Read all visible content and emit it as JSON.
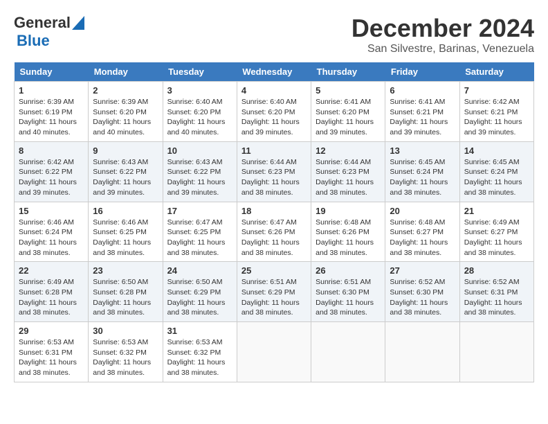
{
  "logo": {
    "general": "General",
    "blue": "Blue"
  },
  "title": "December 2024",
  "subtitle": "San Silvestre, Barinas, Venezuela",
  "days_header": [
    "Sunday",
    "Monday",
    "Tuesday",
    "Wednesday",
    "Thursday",
    "Friday",
    "Saturday"
  ],
  "weeks": [
    [
      {
        "day": "1",
        "sunrise": "Sunrise: 6:39 AM",
        "sunset": "Sunset: 6:19 PM",
        "daylight": "Daylight: 11 hours and 40 minutes."
      },
      {
        "day": "2",
        "sunrise": "Sunrise: 6:39 AM",
        "sunset": "Sunset: 6:20 PM",
        "daylight": "Daylight: 11 hours and 40 minutes."
      },
      {
        "day": "3",
        "sunrise": "Sunrise: 6:40 AM",
        "sunset": "Sunset: 6:20 PM",
        "daylight": "Daylight: 11 hours and 40 minutes."
      },
      {
        "day": "4",
        "sunrise": "Sunrise: 6:40 AM",
        "sunset": "Sunset: 6:20 PM",
        "daylight": "Daylight: 11 hours and 39 minutes."
      },
      {
        "day": "5",
        "sunrise": "Sunrise: 6:41 AM",
        "sunset": "Sunset: 6:20 PM",
        "daylight": "Daylight: 11 hours and 39 minutes."
      },
      {
        "day": "6",
        "sunrise": "Sunrise: 6:41 AM",
        "sunset": "Sunset: 6:21 PM",
        "daylight": "Daylight: 11 hours and 39 minutes."
      },
      {
        "day": "7",
        "sunrise": "Sunrise: 6:42 AM",
        "sunset": "Sunset: 6:21 PM",
        "daylight": "Daylight: 11 hours and 39 minutes."
      }
    ],
    [
      {
        "day": "8",
        "sunrise": "Sunrise: 6:42 AM",
        "sunset": "Sunset: 6:22 PM",
        "daylight": "Daylight: 11 hours and 39 minutes."
      },
      {
        "day": "9",
        "sunrise": "Sunrise: 6:43 AM",
        "sunset": "Sunset: 6:22 PM",
        "daylight": "Daylight: 11 hours and 39 minutes."
      },
      {
        "day": "10",
        "sunrise": "Sunrise: 6:43 AM",
        "sunset": "Sunset: 6:22 PM",
        "daylight": "Daylight: 11 hours and 39 minutes."
      },
      {
        "day": "11",
        "sunrise": "Sunrise: 6:44 AM",
        "sunset": "Sunset: 6:23 PM",
        "daylight": "Daylight: 11 hours and 38 minutes."
      },
      {
        "day": "12",
        "sunrise": "Sunrise: 6:44 AM",
        "sunset": "Sunset: 6:23 PM",
        "daylight": "Daylight: 11 hours and 38 minutes."
      },
      {
        "day": "13",
        "sunrise": "Sunrise: 6:45 AM",
        "sunset": "Sunset: 6:24 PM",
        "daylight": "Daylight: 11 hours and 38 minutes."
      },
      {
        "day": "14",
        "sunrise": "Sunrise: 6:45 AM",
        "sunset": "Sunset: 6:24 PM",
        "daylight": "Daylight: 11 hours and 38 minutes."
      }
    ],
    [
      {
        "day": "15",
        "sunrise": "Sunrise: 6:46 AM",
        "sunset": "Sunset: 6:24 PM",
        "daylight": "Daylight: 11 hours and 38 minutes."
      },
      {
        "day": "16",
        "sunrise": "Sunrise: 6:46 AM",
        "sunset": "Sunset: 6:25 PM",
        "daylight": "Daylight: 11 hours and 38 minutes."
      },
      {
        "day": "17",
        "sunrise": "Sunrise: 6:47 AM",
        "sunset": "Sunset: 6:25 PM",
        "daylight": "Daylight: 11 hours and 38 minutes."
      },
      {
        "day": "18",
        "sunrise": "Sunrise: 6:47 AM",
        "sunset": "Sunset: 6:26 PM",
        "daylight": "Daylight: 11 hours and 38 minutes."
      },
      {
        "day": "19",
        "sunrise": "Sunrise: 6:48 AM",
        "sunset": "Sunset: 6:26 PM",
        "daylight": "Daylight: 11 hours and 38 minutes."
      },
      {
        "day": "20",
        "sunrise": "Sunrise: 6:48 AM",
        "sunset": "Sunset: 6:27 PM",
        "daylight": "Daylight: 11 hours and 38 minutes."
      },
      {
        "day": "21",
        "sunrise": "Sunrise: 6:49 AM",
        "sunset": "Sunset: 6:27 PM",
        "daylight": "Daylight: 11 hours and 38 minutes."
      }
    ],
    [
      {
        "day": "22",
        "sunrise": "Sunrise: 6:49 AM",
        "sunset": "Sunset: 6:28 PM",
        "daylight": "Daylight: 11 hours and 38 minutes."
      },
      {
        "day": "23",
        "sunrise": "Sunrise: 6:50 AM",
        "sunset": "Sunset: 6:28 PM",
        "daylight": "Daylight: 11 hours and 38 minutes."
      },
      {
        "day": "24",
        "sunrise": "Sunrise: 6:50 AM",
        "sunset": "Sunset: 6:29 PM",
        "daylight": "Daylight: 11 hours and 38 minutes."
      },
      {
        "day": "25",
        "sunrise": "Sunrise: 6:51 AM",
        "sunset": "Sunset: 6:29 PM",
        "daylight": "Daylight: 11 hours and 38 minutes."
      },
      {
        "day": "26",
        "sunrise": "Sunrise: 6:51 AM",
        "sunset": "Sunset: 6:30 PM",
        "daylight": "Daylight: 11 hours and 38 minutes."
      },
      {
        "day": "27",
        "sunrise": "Sunrise: 6:52 AM",
        "sunset": "Sunset: 6:30 PM",
        "daylight": "Daylight: 11 hours and 38 minutes."
      },
      {
        "day": "28",
        "sunrise": "Sunrise: 6:52 AM",
        "sunset": "Sunset: 6:31 PM",
        "daylight": "Daylight: 11 hours and 38 minutes."
      }
    ],
    [
      {
        "day": "29",
        "sunrise": "Sunrise: 6:53 AM",
        "sunset": "Sunset: 6:31 PM",
        "daylight": "Daylight: 11 hours and 38 minutes."
      },
      {
        "day": "30",
        "sunrise": "Sunrise: 6:53 AM",
        "sunset": "Sunset: 6:32 PM",
        "daylight": "Daylight: 11 hours and 38 minutes."
      },
      {
        "day": "31",
        "sunrise": "Sunrise: 6:53 AM",
        "sunset": "Sunset: 6:32 PM",
        "daylight": "Daylight: 11 hours and 38 minutes."
      },
      null,
      null,
      null,
      null
    ]
  ]
}
